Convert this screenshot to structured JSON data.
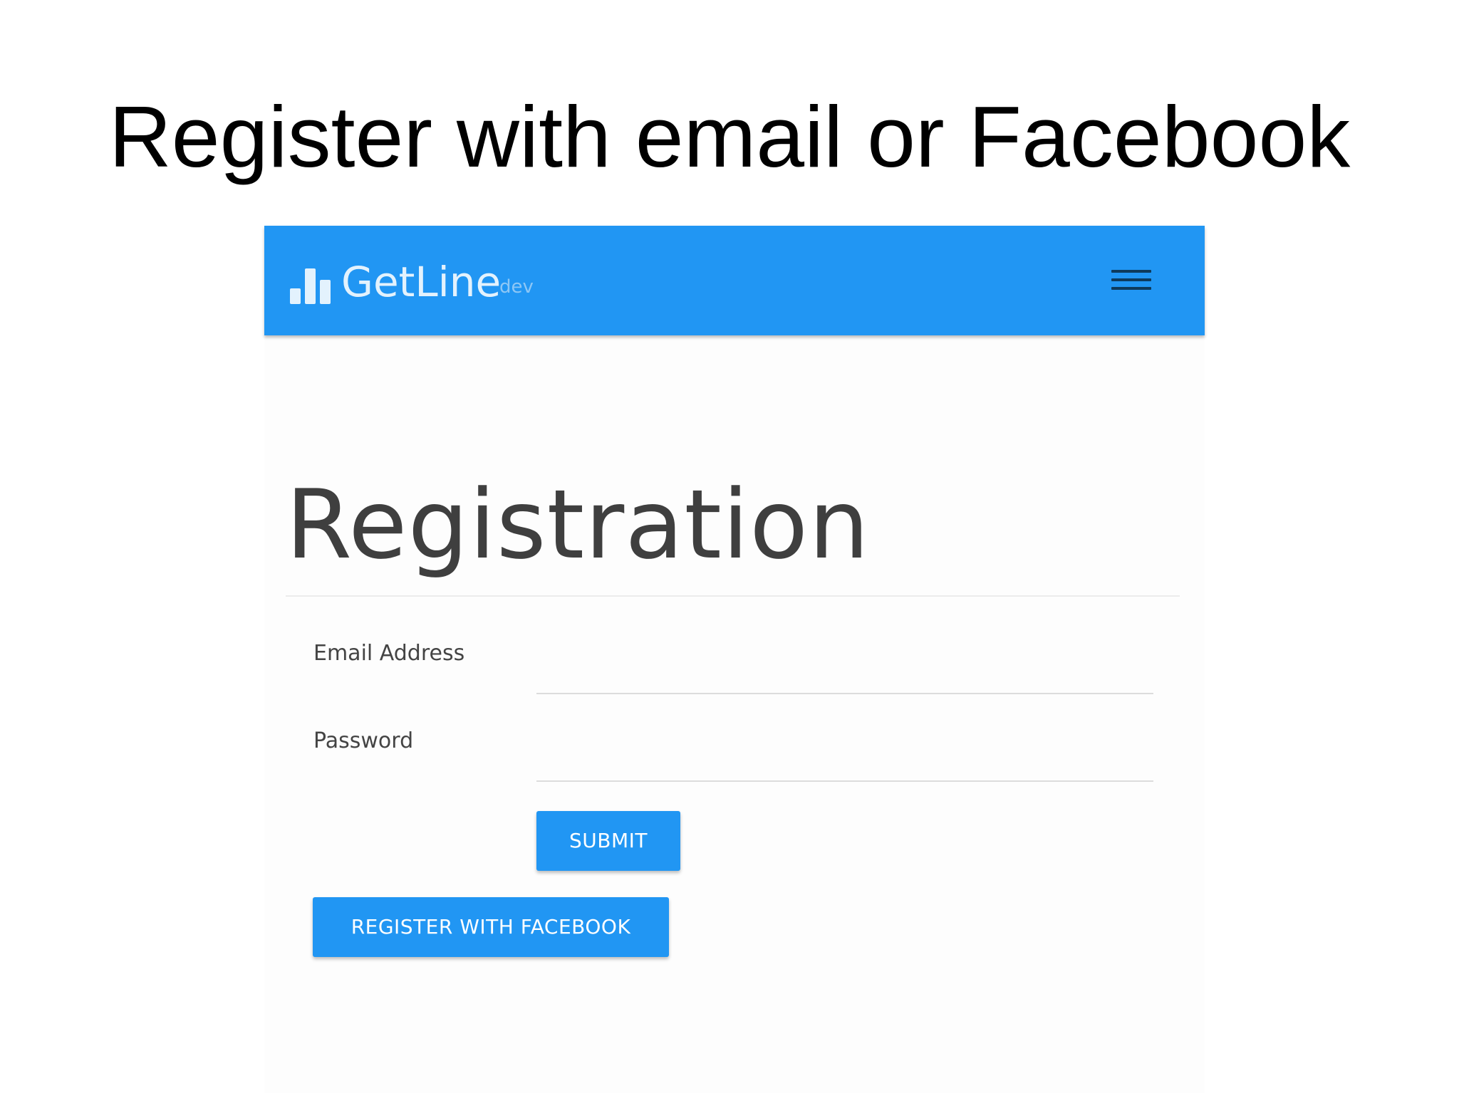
{
  "slide": {
    "title": "Register with email or Facebook"
  },
  "navbar": {
    "brand_name": "GetLine",
    "brand_tag": "dev",
    "brand_icon": "bar-chart-icon",
    "menu_icon": "hamburger-menu-icon",
    "background_color": "#2196f3"
  },
  "page": {
    "heading": "Registration"
  },
  "form": {
    "email_label": "Email Address",
    "email_value": "",
    "password_label": "Password",
    "password_value": "",
    "submit_label": "SUBMIT",
    "facebook_label": "REGISTER WITH FACEBOOK",
    "button_color": "#2196f3"
  }
}
